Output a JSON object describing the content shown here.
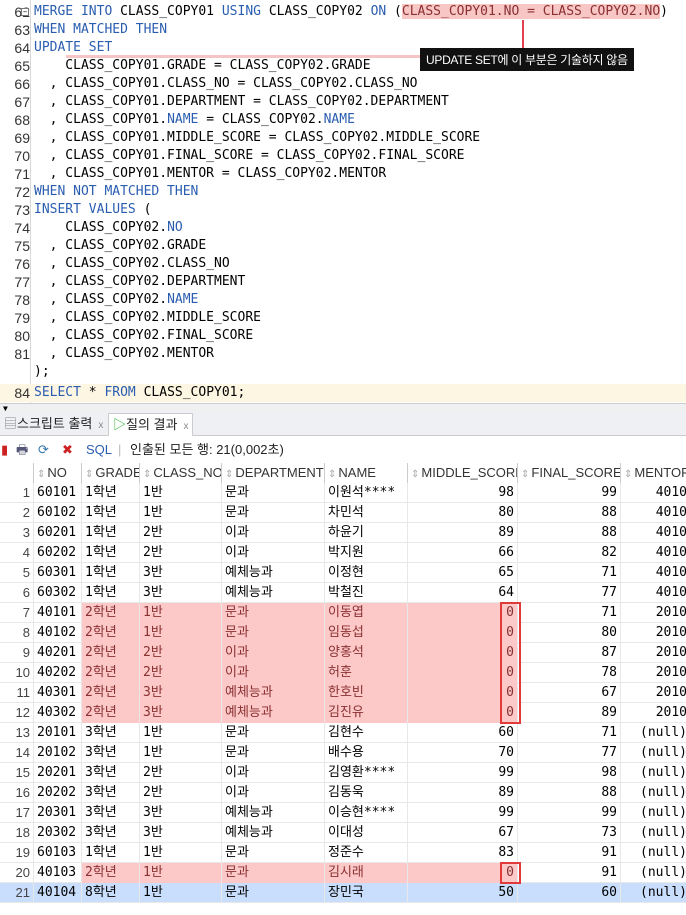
{
  "editor": {
    "callout": "UPDATE SET에 이 부분은 기술하지 않음",
    "lines": [
      {
        "n": "62",
        "parts": [
          [
            "kw",
            "MERGE INTO "
          ],
          [
            "",
            "CLASS_COPY01 "
          ],
          [
            "kw",
            "USING "
          ],
          [
            "",
            "CLASS_COPY02 "
          ],
          [
            "kw",
            "ON "
          ],
          [
            "",
            "("
          ],
          [
            "hl",
            "CLASS_COPY01.NO = CLASS_COPY02.NO"
          ],
          [
            "",
            ")"
          ]
        ]
      },
      {
        "n": "63",
        "parts": [
          [
            "kw",
            "WHEN MATCHED THEN"
          ]
        ]
      },
      {
        "n": "64",
        "parts": [
          [
            "kw",
            "UPDATE SET"
          ]
        ]
      },
      {
        "n": "65",
        "parts": [
          [
            "",
            "    CLASS_COPY01.GRADE = CLASS_COPY02.GRADE"
          ]
        ]
      },
      {
        "n": "66",
        "parts": [
          [
            "",
            "  , CLASS_COPY01.CLASS_NO = CLASS_COPY02.CLASS_NO"
          ]
        ]
      },
      {
        "n": "67",
        "parts": [
          [
            "",
            "  , CLASS_COPY01.DEPARTMENT = CLASS_COPY02.DEPARTMENT"
          ]
        ]
      },
      {
        "n": "68",
        "parts": [
          [
            "",
            "  , CLASS_COPY01."
          ],
          [
            "kw",
            "NAME"
          ],
          [
            "",
            " = CLASS_COPY02."
          ],
          [
            "kw",
            "NAME"
          ]
        ]
      },
      {
        "n": "69",
        "parts": [
          [
            "",
            "  , CLASS_COPY01.MIDDLE_SCORE = CLASS_COPY02.MIDDLE_SCORE"
          ]
        ]
      },
      {
        "n": "70",
        "parts": [
          [
            "",
            "  , CLASS_COPY01.FINAL_SCORE = CLASS_COPY02.FINAL_SCORE"
          ]
        ]
      },
      {
        "n": "71",
        "parts": [
          [
            "",
            "  , CLASS_COPY01.MENTOR = CLASS_COPY02.MENTOR"
          ]
        ]
      },
      {
        "n": "72",
        "parts": [
          [
            "kw",
            "WHEN NOT MATCHED THEN"
          ]
        ]
      },
      {
        "n": "73",
        "parts": [
          [
            "kw",
            "INSERT VALUES "
          ],
          [
            "",
            "("
          ]
        ]
      },
      {
        "n": "74",
        "parts": [
          [
            "",
            "    CLASS_COPY02."
          ],
          [
            "kw",
            "NO"
          ]
        ]
      },
      {
        "n": "75",
        "parts": [
          [
            "",
            "  , CLASS_COPY02.GRADE"
          ]
        ]
      },
      {
        "n": "76",
        "parts": [
          [
            "",
            "  , CLASS_COPY02.CLASS_NO"
          ]
        ]
      },
      {
        "n": "77",
        "parts": [
          [
            "",
            "  , CLASS_COPY02.DEPARTMENT"
          ]
        ]
      },
      {
        "n": "78",
        "parts": [
          [
            "",
            "  , CLASS_COPY02."
          ],
          [
            "kw",
            "NAME"
          ]
        ]
      },
      {
        "n": "79",
        "parts": [
          [
            "",
            "  , CLASS_COPY02.MIDDLE_SCORE"
          ]
        ]
      },
      {
        "n": "80",
        "parts": [
          [
            "",
            "  , CLASS_COPY02.FINAL_SCORE"
          ]
        ]
      },
      {
        "n": "81",
        "parts": [
          [
            "",
            "  , CLASS_COPY02.MENTOR"
          ]
        ]
      },
      {
        "n": "",
        "parts": [
          [
            "",
            ");"
          ]
        ]
      },
      {
        "n": "84",
        "parts": [
          [
            "kw",
            "SELECT "
          ],
          [
            "",
            "* "
          ],
          [
            "kw",
            "FROM "
          ],
          [
            "",
            "CLASS_COPY01;"
          ]
        ]
      }
    ]
  },
  "tabs": [
    {
      "label": "스크립트 출력",
      "close": "x"
    },
    {
      "label": "질의 결과",
      "close": "x"
    }
  ],
  "toolbar": {
    "sql": "SQL",
    "status": "인출된 모든 행: 21(0,002초)"
  },
  "grid": {
    "columns": [
      "",
      "NO",
      "GRADE",
      "CLASS_NO",
      "DEPARTMENT",
      "NAME",
      "MIDDLE_SCORE",
      "FINAL_SCORE",
      "MENTOR"
    ],
    "rows": [
      [
        "1",
        "60101",
        "1학년",
        "1반",
        "문과",
        "이원석****",
        "98",
        "99",
        "4010"
      ],
      [
        "2",
        "60102",
        "1학년",
        "1반",
        "문과",
        "차민석",
        "80",
        "88",
        "4010"
      ],
      [
        "3",
        "60201",
        "1학년",
        "2반",
        "이과",
        "하윤기",
        "89",
        "88",
        "4010"
      ],
      [
        "4",
        "60202",
        "1학년",
        "2반",
        "이과",
        "박지원",
        "66",
        "82",
        "4010"
      ],
      [
        "5",
        "60301",
        "1학년",
        "3반",
        "예체능과",
        "이정현",
        "65",
        "71",
        "4010"
      ],
      [
        "6",
        "60302",
        "1학년",
        "3반",
        "예체능과",
        "박철진",
        "64",
        "77",
        "4010"
      ],
      [
        "7",
        "40101",
        "2학년",
        "1반",
        "문과",
        "이동엽",
        "0",
        "71",
        "2010"
      ],
      [
        "8",
        "40102",
        "2학년",
        "1반",
        "문과",
        "임동섭",
        "0",
        "80",
        "2010"
      ],
      [
        "9",
        "40201",
        "2학년",
        "2반",
        "이과",
        "양홍석",
        "0",
        "87",
        "2010"
      ],
      [
        "10",
        "40202",
        "2학년",
        "2반",
        "이과",
        "허훈",
        "0",
        "78",
        "2010"
      ],
      [
        "11",
        "40301",
        "2학년",
        "3반",
        "예체능과",
        "한호빈",
        "0",
        "67",
        "2010"
      ],
      [
        "12",
        "40302",
        "2학년",
        "3반",
        "예체능과",
        "김진유",
        "0",
        "89",
        "2010"
      ],
      [
        "13",
        "20101",
        "3학년",
        "1반",
        "문과",
        "김현수",
        "60",
        "71",
        "(null)"
      ],
      [
        "14",
        "20102",
        "3학년",
        "1반",
        "문과",
        "배수용",
        "70",
        "77",
        "(null)"
      ],
      [
        "15",
        "20201",
        "3학년",
        "2반",
        "이과",
        "김영환****",
        "99",
        "98",
        "(null)"
      ],
      [
        "16",
        "20202",
        "3학년",
        "2반",
        "이과",
        "김동욱",
        "89",
        "88",
        "(null)"
      ],
      [
        "17",
        "20301",
        "3학년",
        "3반",
        "예체능과",
        "이승현****",
        "99",
        "99",
        "(null)"
      ],
      [
        "18",
        "20302",
        "3학년",
        "3반",
        "예체능과",
        "이대성",
        "67",
        "73",
        "(null)"
      ],
      [
        "19",
        "60103",
        "1학년",
        "1반",
        "문과",
        "정준수",
        "83",
        "91",
        "(null)"
      ],
      [
        "20",
        "40103",
        "2학년",
        "1반",
        "문과",
        "김시래",
        "0",
        "91",
        "(null)"
      ],
      [
        "21",
        "40104",
        "8학년",
        "1반",
        "문과",
        "장민국",
        "50",
        "60",
        "(null)"
      ]
    ],
    "highlighted_rows": [
      7,
      8,
      9,
      10,
      11,
      12,
      20
    ],
    "selected_row": 21,
    "colors": {
      "highlight": "#fcc8c8",
      "selected": "#c9defc",
      "box": "#e03a3a"
    }
  }
}
